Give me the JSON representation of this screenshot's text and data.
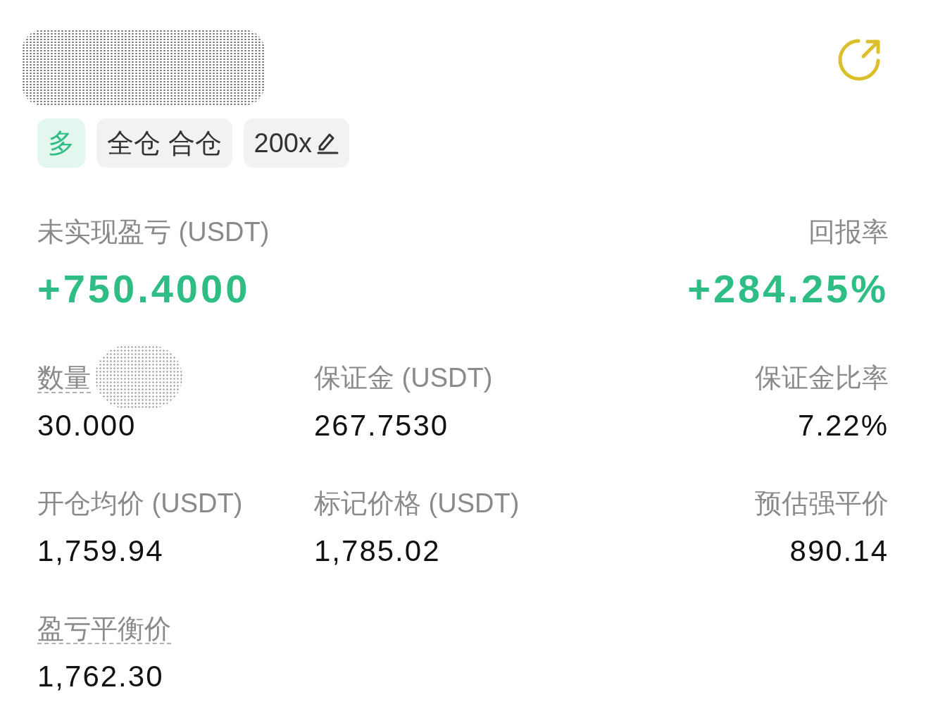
{
  "tags": [
    {
      "kind": "long",
      "label": "多"
    },
    {
      "kind": "plain",
      "label": "全仓 合仓"
    },
    {
      "kind": "plain",
      "label": "200x",
      "editable": true
    }
  ],
  "summary": [
    {
      "label": "未实现盈亏 (USDT)",
      "value": "+750.4000",
      "positive": true
    },
    {
      "label": "回报率",
      "value": "+284.25%",
      "positive": true
    }
  ],
  "fields": [
    {
      "label": "数量",
      "value": "30.000",
      "hint": true
    },
    {
      "label": "保证金 (USDT)",
      "value": "267.7530",
      "hint": false
    },
    {
      "label": "保证金比率",
      "value": "7.22%",
      "hint": false
    },
    {
      "label": "开仓均价 (USDT)",
      "value": "1,759.94",
      "hint": false
    },
    {
      "label": "标记价格 (USDT)",
      "value": "1,785.02",
      "hint": false
    },
    {
      "label": "预估强平价",
      "value": "890.14",
      "hint": false
    },
    {
      "label": "盈亏平衡价",
      "value": "1,762.30",
      "hint": true
    }
  ]
}
